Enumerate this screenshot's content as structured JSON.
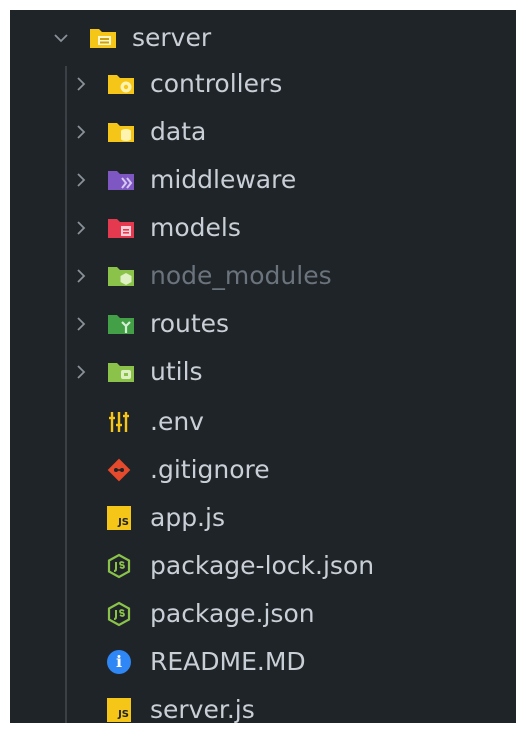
{
  "root": {
    "label": "server",
    "expanded": true
  },
  "folders": [
    {
      "label": "controllers",
      "icon": "folder-controllers-icon",
      "color": "#f5c518",
      "dimmed": false
    },
    {
      "label": "data",
      "icon": "folder-data-icon",
      "color": "#f5c518",
      "dimmed": false
    },
    {
      "label": "middleware",
      "icon": "folder-middleware-icon",
      "color": "#7e57c2",
      "dimmed": false
    },
    {
      "label": "models",
      "icon": "folder-models-icon",
      "color": "#e53950",
      "dimmed": false
    },
    {
      "label": "node_modules",
      "icon": "folder-node-icon",
      "color": "#8bc34a",
      "dimmed": true
    },
    {
      "label": "routes",
      "icon": "folder-routes-icon",
      "color": "#43a047",
      "dimmed": false
    },
    {
      "label": "utils",
      "icon": "folder-utils-icon",
      "color": "#8bc34a",
      "dimmed": false
    }
  ],
  "files": [
    {
      "label": ".env",
      "icon": "env-settings-icon",
      "color": "#f5c518"
    },
    {
      "label": ".gitignore",
      "icon": "git-icon",
      "color": "#e44a2b"
    },
    {
      "label": "app.js",
      "icon": "javascript-icon",
      "color": "#f5c518",
      "glyph": "JS"
    },
    {
      "label": "package-lock.json",
      "icon": "nodejs-icon",
      "color": "#8bc34a"
    },
    {
      "label": "package.json",
      "icon": "nodejs-icon",
      "color": "#8bc34a"
    },
    {
      "label": "README.MD",
      "icon": "info-icon",
      "color": "#2f86f5",
      "glyph": "i"
    },
    {
      "label": "server.js",
      "icon": "javascript-icon",
      "color": "#f5c518",
      "glyph": "JS"
    }
  ],
  "colors": {
    "background": "#1f2428",
    "text": "#c9cfd6",
    "dimmed_text": "#6b737c",
    "chevron": "#8a9199"
  }
}
